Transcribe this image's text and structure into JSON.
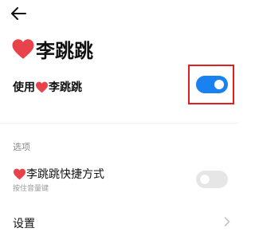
{
  "header": {
    "back_icon": "arrow-left-icon",
    "title": "李跳跳"
  },
  "main_toggle": {
    "label": "使用",
    "label_name": "李跳跳",
    "state": "on",
    "accent_color": "#1a82f0"
  },
  "options_section": {
    "header": "选项",
    "shortcut": {
      "label": "李跳跳快捷方式",
      "sublabel": "按住音量键",
      "state": "off"
    },
    "settings": {
      "label": "设置",
      "chevron_icon": "chevron-right-icon"
    }
  },
  "colors": {
    "heart": "#e8424a",
    "highlight": "#e02020"
  }
}
